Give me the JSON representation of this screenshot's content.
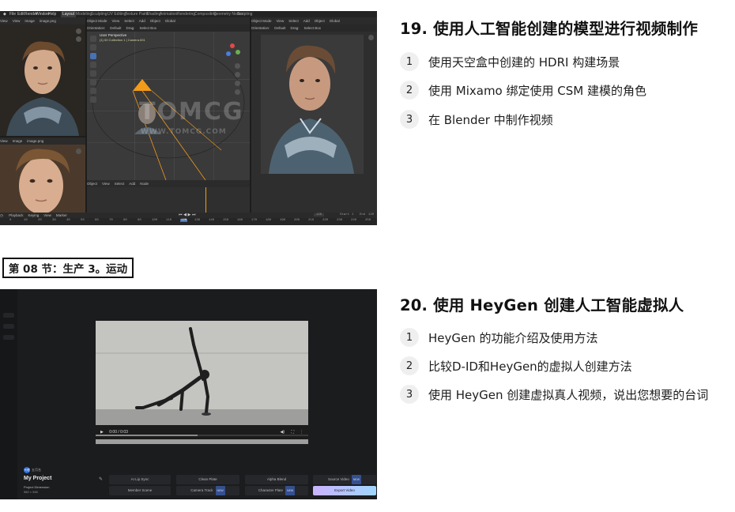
{
  "section1": {
    "title": "19. 使用人工智能创建的模型进行视频制作",
    "items": [
      {
        "num": "1",
        "text": "使用天空盒中创建的 HDRI 构建场景"
      },
      {
        "num": "2",
        "text": "使用 Mixamo 绑定使用 CSM 建模的角色"
      },
      {
        "num": "3",
        "text": "在 Blender 中制作视频"
      }
    ]
  },
  "section_label": "第 08 节：生产 3。运动",
  "section2": {
    "title": "20. 使用 HeyGen 创建人工智能虚拟人",
    "items": [
      {
        "num": "1",
        "text": "HeyGen 的功能介绍及使用方法"
      },
      {
        "num": "2",
        "text": "比较D-ID和HeyGen的虚拟人创建方法"
      },
      {
        "num": "3",
        "text": "使用 HeyGen 创建虚拟真人视频，说出您想要的台词"
      }
    ]
  },
  "blender": {
    "menus": [
      "File",
      "Edit",
      "Render",
      "Window",
      "Help"
    ],
    "tabs": [
      "Layout",
      "Modeling",
      "Sculpting",
      "UV Editing",
      "Texture Paint",
      "Shading",
      "Animation",
      "Rendering",
      "Compositing",
      "Geometry Nodes",
      "Scripting"
    ],
    "left_header": [
      "View",
      "View",
      "Image",
      "image.png"
    ],
    "left_header2": [
      "View",
      "Image",
      "image.png"
    ],
    "viewport_header": [
      "Object Mode",
      "View",
      "Select",
      "Add",
      "Object",
      "Global"
    ],
    "viewport_header2": [
      "Orientation:",
      "Default",
      "Drag:",
      "Select Box"
    ],
    "viewport_label": "User Perspective",
    "viewport_collection": "(1) 00 Collection 1 | Camera.001",
    "render_header": [
      "Object Mode",
      "View",
      "Select",
      "Add",
      "Object",
      "Global"
    ],
    "render_header2": [
      "Orientation:",
      "Default",
      "Drag:",
      "Select Box"
    ],
    "watermark": "TOMCG",
    "watermark_sub": "WWW.TOMCG.COM",
    "timeline_menu": [
      "Playback",
      "Keying",
      "View",
      "Marker"
    ],
    "frame_current": "120",
    "start_label": "Start",
    "start_value": "1",
    "end_label": "End",
    "end_value": "120",
    "ticks": [
      "0",
      "10",
      "20",
      "30",
      "40",
      "50",
      "60",
      "70",
      "80",
      "90",
      "100",
      "110",
      "120",
      "130",
      "140",
      "150",
      "160",
      "170",
      "180",
      "190",
      "200",
      "210",
      "220",
      "230",
      "240",
      "250"
    ],
    "viewport_bottom": [
      "Object",
      "View",
      "Select",
      "Add",
      "Node"
    ]
  },
  "heygen": {
    "time": "0:00 / 0:03",
    "avatar_initials": "代理",
    "user_name": "五月名",
    "project_title": "My Project",
    "project_sub": "Project Dimension",
    "project_dims": "960 × 540",
    "buttons_row1": [
      "AI Lip Sync",
      "Clean Plate",
      "Alpha Blend",
      "Source Video"
    ],
    "buttons_row2": [
      "Member Scene",
      "Camera Track",
      "Character Plate",
      "Export Video"
    ],
    "tag": "NEW",
    "colors": {
      "export_gradient_start": "#c9b3ff",
      "export_gradient_end": "#9fd6ff"
    }
  }
}
